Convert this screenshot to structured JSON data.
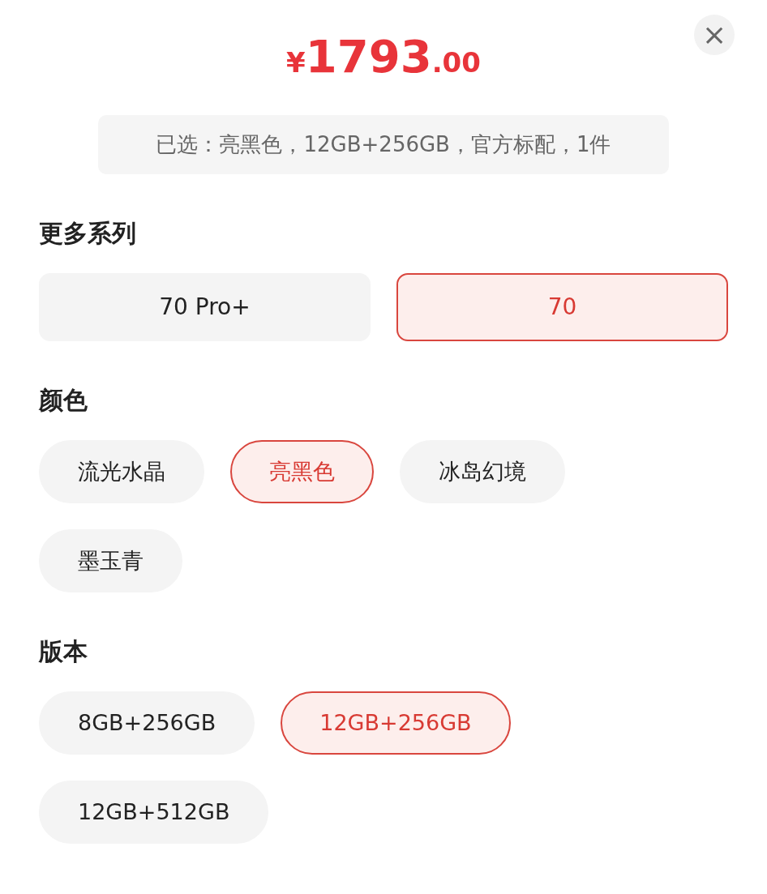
{
  "price": {
    "currency": "¥",
    "integer": "1793",
    "decimal": ".00"
  },
  "close": {
    "label": "×"
  },
  "summary": "已选：亮黑色，12GB+256GB，官方标配，1件",
  "sections": [
    {
      "title": "更多系列",
      "kind": "grid",
      "options": [
        {
          "label": "70 Pro+",
          "selected": false
        },
        {
          "label": "70",
          "selected": true
        }
      ]
    },
    {
      "title": "颜色",
      "kind": "pills",
      "options": [
        {
          "label": "流光水晶",
          "selected": false
        },
        {
          "label": "亮黑色",
          "selected": true
        },
        {
          "label": "冰岛幻境",
          "selected": false
        },
        {
          "label": "墨玉青",
          "selected": false
        }
      ]
    },
    {
      "title": "版本",
      "kind": "pills",
      "options": [
        {
          "label": "8GB+256GB",
          "selected": false
        },
        {
          "label": "12GB+256GB",
          "selected": true
        },
        {
          "label": "12GB+512GB",
          "selected": false
        }
      ]
    }
  ]
}
